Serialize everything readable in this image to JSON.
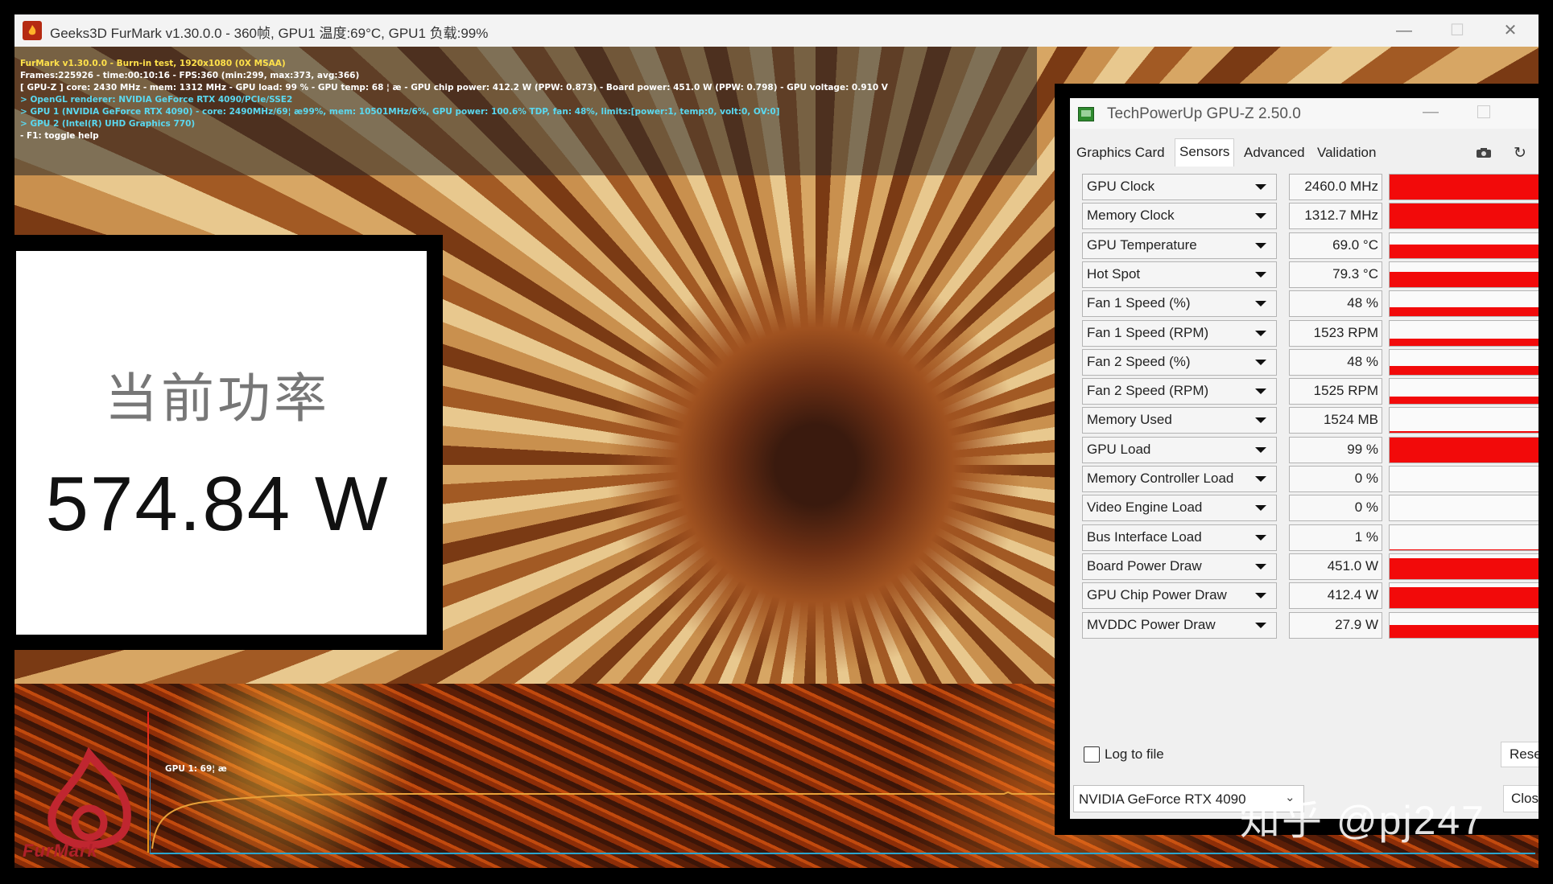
{
  "furmark": {
    "title": "Geeks3D FurMark v1.30.0.0 - 360帧, GPU1 温度:69°C, GPU1 负载:99%",
    "window_controls": {
      "minimize": "—",
      "maximize": "☐",
      "close": "✕"
    },
    "info_lines": [
      "FurMark v1.30.0.0 - Burn-in test, 1920x1080 (0X MSAA)",
      "Frames:225926 - time:00:10:16 - FPS:360 (min:299, max:373, avg:366)",
      "[ GPU-Z ] core: 2430 MHz - mem: 1312 MHz - GPU load: 99 % - GPU temp: 68 ¦ æ - GPU chip power: 412.2 W (PPW: 0.873) - Board power: 451.0 W (PPW: 0.798) - GPU voltage: 0.910 V",
      "> OpenGL renderer: NVIDIA GeForce RTX 4090/PCIe/SSE2",
      "> GPU 1 (NVIDIA GeForce RTX 4090) - core: 2490MHz/69¦ æ99%, mem: 10501MHz/6%, GPU power: 100.6% TDP, fan: 48%, limits:[power:1, temp:0, volt:0, OV:0]",
      "> GPU 2 (Intel(R) UHD Graphics 770)",
      "- F1: toggle help"
    ],
    "graph_label": "GPU 1: 69¦ æ",
    "logo_text": "FurMark"
  },
  "power_overlay": {
    "label": "当前功率",
    "value": "574.84 W"
  },
  "gpuz": {
    "title": "TechPowerUp GPU-Z 2.50.0",
    "tabs": [
      "Graphics Card",
      "Sensors",
      "Advanced",
      "Validation"
    ],
    "active_tab": "Sensors",
    "sensors": [
      {
        "name": "GPU Clock",
        "value": "2460.0 MHz",
        "level": 1.0
      },
      {
        "name": "Memory Clock",
        "value": "1312.7 MHz",
        "level": 1.0
      },
      {
        "name": "GPU Temperature",
        "value": "69.0 °C",
        "level": 0.55
      },
      {
        "name": "Hot Spot",
        "value": "79.3 °C",
        "level": 0.6
      },
      {
        "name": "Fan 1 Speed (%)",
        "value": "48 %",
        "level": 0.35
      },
      {
        "name": "Fan 1 Speed (RPM)",
        "value": "1523 RPM",
        "level": 0.3
      },
      {
        "name": "Fan 2 Speed (%)",
        "value": "48 %",
        "level": 0.35
      },
      {
        "name": "Fan 2 Speed (RPM)",
        "value": "1525 RPM",
        "level": 0.3
      },
      {
        "name": "Memory Used",
        "value": "1524 MB",
        "level": 0.08
      },
      {
        "name": "GPU Load",
        "value": "99 %",
        "level": 0.99
      },
      {
        "name": "Memory Controller Load",
        "value": "0 %",
        "level": 0.0
      },
      {
        "name": "Video Engine Load",
        "value": "0 %",
        "level": 0.0
      },
      {
        "name": "Bus Interface Load",
        "value": "1 %",
        "level": 0.02
      },
      {
        "name": "Board Power Draw",
        "value": "451.0 W",
        "level": 0.85
      },
      {
        "name": "GPU Chip Power Draw",
        "value": "412.4 W",
        "level": 0.85
      },
      {
        "name": "MVDDC Power Draw",
        "value": "27.9 W",
        "level": 0.5
      }
    ],
    "log_to_file": "Log to file",
    "reset_label": "Reset",
    "gpu_select": "NVIDIA GeForce RTX 4090",
    "close_label": "Close",
    "colors": {
      "bar": "#f20a0a"
    }
  },
  "watermark": "知乎 @pj247"
}
